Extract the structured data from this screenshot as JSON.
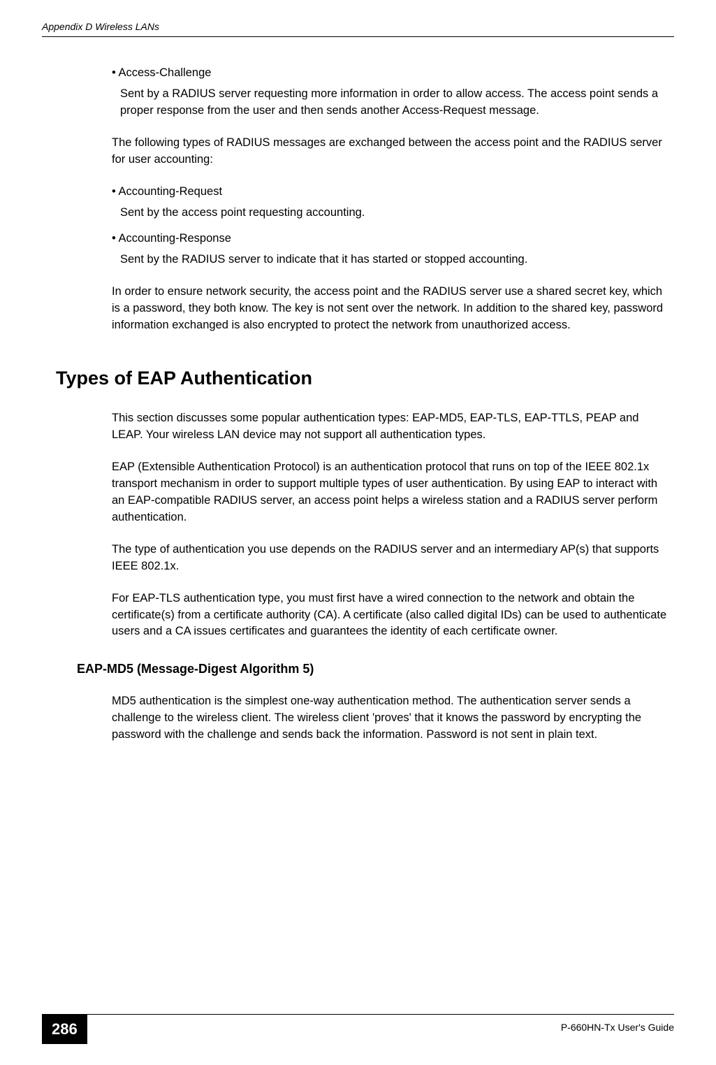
{
  "header": {
    "title": "Appendix D Wireless LANs"
  },
  "body": {
    "bullet1_label": "• Access-Challenge",
    "bullet1_desc": "Sent by a RADIUS server requesting more information in order to allow access. The access point sends a proper response from the user and then sends another Access-Request message.",
    "para1": "The following types of RADIUS messages are exchanged between the access point and the RADIUS server for user accounting:",
    "bullet2_label": "• Accounting-Request",
    "bullet2_desc": "Sent by the access point requesting accounting.",
    "bullet3_label": "• Accounting-Response",
    "bullet3_desc": "Sent by the RADIUS server to indicate that it has started or stopped accounting.",
    "para2": "In order to ensure network security, the access point and the RADIUS server use a shared secret key, which is a password, they both know. The key is not sent over the network. In addition to the shared key, password information exchanged is also encrypted to protect the network from unauthorized access.",
    "section_title": "Types of EAP Authentication",
    "para3": "This section discusses some popular authentication types: EAP-MD5, EAP-TLS, EAP-TTLS, PEAP and LEAP. Your wireless LAN device may not support all authentication types.",
    "para4": "EAP (Extensible Authentication Protocol) is an authentication protocol that runs on top of the IEEE 802.1x transport mechanism in order to support multiple types of user authentication. By using EAP to interact with an EAP-compatible RADIUS server, an access point helps a wireless station and a RADIUS server perform authentication.",
    "para5": "The type of authentication you use depends on the RADIUS server and an intermediary AP(s) that supports IEEE 802.1x.",
    "para6": "For EAP-TLS authentication type, you must first have a wired connection to the network and obtain the certificate(s) from a certificate authority (CA). A certificate (also called digital IDs) can be used to authenticate users and a CA issues certificates and guarantees the identity of each certificate owner.",
    "subsection_title": "EAP-MD5 (Message-Digest Algorithm 5)",
    "para7": "MD5 authentication is the simplest one-way authentication method. The authentication server sends a challenge to the wireless client. The wireless client 'proves' that it knows the password by encrypting the password with the challenge and sends back the information. Password is not sent in plain text."
  },
  "footer": {
    "page_number": "286",
    "guide": "P-660HN-Tx User's Guide"
  }
}
